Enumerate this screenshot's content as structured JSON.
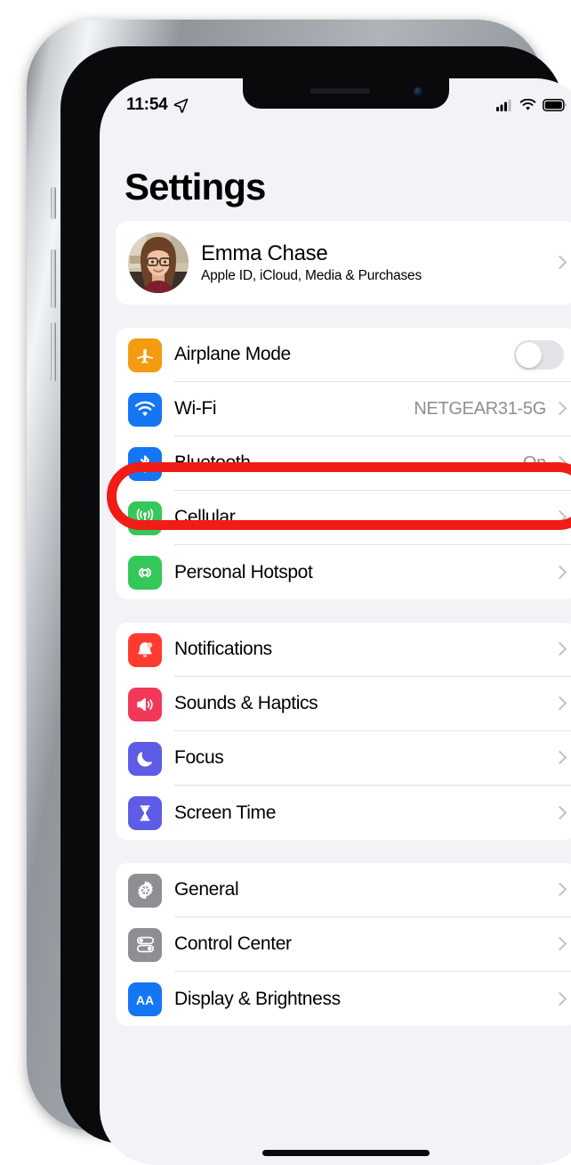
{
  "status_bar": {
    "time": "11:54",
    "icons": [
      "location-arrow-icon",
      "cellular-signal-icon",
      "wifi-icon",
      "battery-icon"
    ]
  },
  "header": {
    "title": "Settings"
  },
  "apple_id": {
    "name": "Emma Chase",
    "subtitle": "Apple ID, iCloud, Media & Purchases",
    "avatar_alt": "avatar"
  },
  "groups": [
    {
      "id": "connectivity",
      "rows": [
        {
          "icon": "airplane-icon",
          "icon_color": "#f39c12",
          "label": "Airplane Mode",
          "value": "",
          "accessory": "toggle",
          "toggle_on": false
        },
        {
          "icon": "wifi-icon",
          "icon_color": "#1476f2",
          "label": "Wi-Fi",
          "value": "NETGEAR31-5G",
          "accessory": "chevron",
          "highlighted": true
        },
        {
          "icon": "bluetooth-icon",
          "icon_color": "#1476f2",
          "label": "Bluetooth",
          "value": "On",
          "accessory": "chevron"
        },
        {
          "icon": "cellular-icon",
          "icon_color": "#34c759",
          "label": "Cellular",
          "value": "",
          "accessory": "chevron"
        },
        {
          "icon": "hotspot-icon",
          "icon_color": "#34c759",
          "label": "Personal Hotspot",
          "value": "",
          "accessory": "chevron"
        }
      ]
    },
    {
      "id": "alerts",
      "rows": [
        {
          "icon": "notification-bell-icon",
          "icon_color": "#ff3b30",
          "label": "Notifications",
          "value": "",
          "accessory": "chevron"
        },
        {
          "icon": "speaker-icon",
          "icon_color": "#f2385a",
          "label": "Sounds & Haptics",
          "value": "",
          "accessory": "chevron"
        },
        {
          "icon": "moon-icon",
          "icon_color": "#5e5ce6",
          "label": "Focus",
          "value": "",
          "accessory": "chevron"
        },
        {
          "icon": "hourglass-icon",
          "icon_color": "#5e5ce6",
          "label": "Screen Time",
          "value": "",
          "accessory": "chevron"
        }
      ]
    },
    {
      "id": "system",
      "rows": [
        {
          "icon": "gear-icon",
          "icon_color": "#8e8e93",
          "label": "General",
          "value": "",
          "accessory": "chevron"
        },
        {
          "icon": "control-center-icon",
          "icon_color": "#8e8e93",
          "label": "Control Center",
          "value": "",
          "accessory": "chevron"
        },
        {
          "icon": "display-aa-icon",
          "icon_color": "#1476f2",
          "label": "Display & Brightness",
          "value": "",
          "accessory": "chevron"
        }
      ]
    }
  ],
  "annotation": {
    "type": "red-oval-highlight",
    "target_row_label": "Wi-Fi",
    "color": "#f01c16"
  },
  "colors": {
    "screen_background": "#f2f2f7",
    "card_background": "#ffffff",
    "secondary_text": "#8e8e93",
    "separator": "#e2e2e6"
  }
}
